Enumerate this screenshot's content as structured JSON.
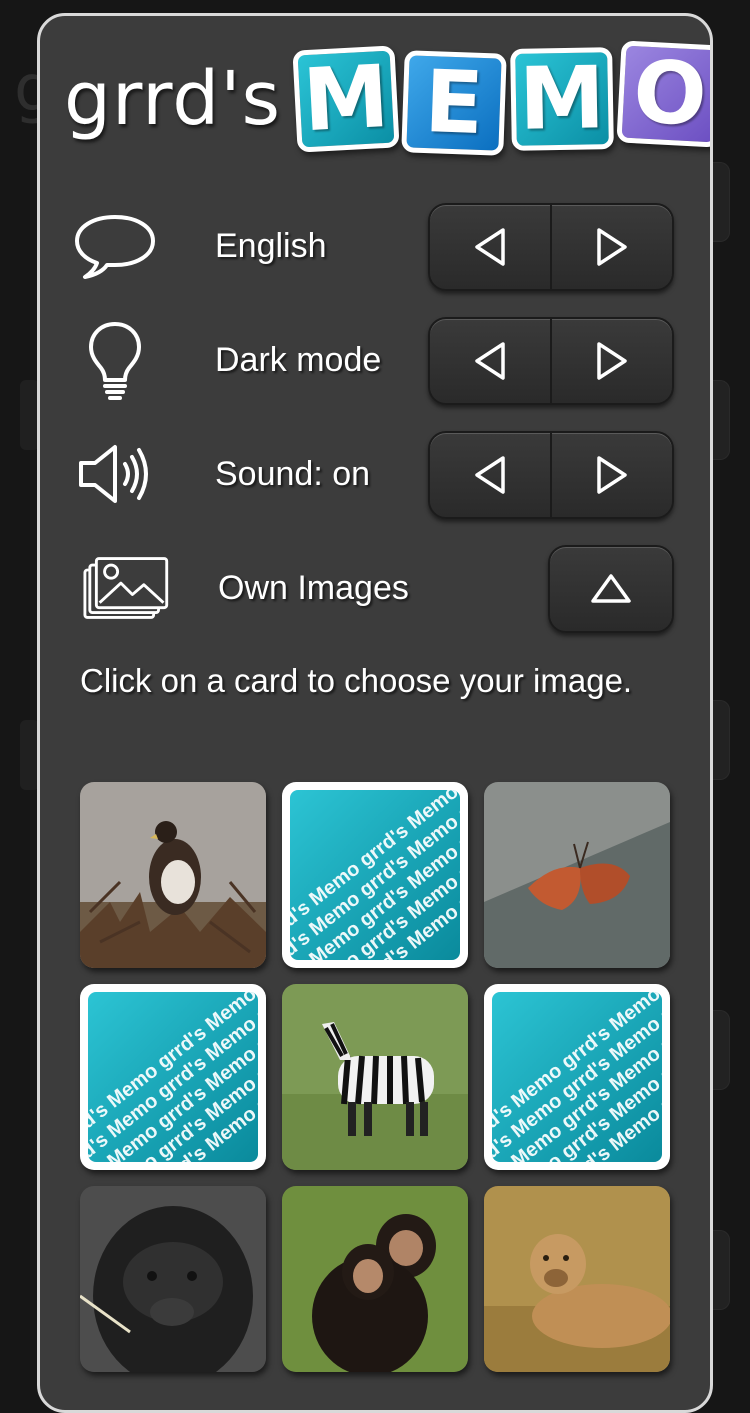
{
  "app": {
    "title_prefix": "grrd's",
    "title_letters": [
      "M",
      "E",
      "M",
      "O"
    ]
  },
  "settings": [
    {
      "label": "English",
      "icon": "speech-bubble-icon",
      "control": "arrows"
    },
    {
      "label": "Dark mode",
      "icon": "lightbulb-icon",
      "control": "arrows"
    },
    {
      "label": "Sound: on",
      "icon": "speaker-icon",
      "control": "arrows"
    },
    {
      "label": "Own Images",
      "icon": "images-icon",
      "control": "collapse"
    }
  ],
  "instruction": "Click on a card to choose your image.",
  "card_back_text": "grrd's Memo grrd's Memo grrd's",
  "cards": [
    {
      "type": "photo",
      "subject": "eagle"
    },
    {
      "type": "back"
    },
    {
      "type": "photo",
      "subject": "butterfly"
    },
    {
      "type": "back"
    },
    {
      "type": "photo",
      "subject": "zebra"
    },
    {
      "type": "back"
    },
    {
      "type": "photo",
      "subject": "gorilla"
    },
    {
      "type": "photo",
      "subject": "chimpanzees"
    },
    {
      "type": "photo",
      "subject": "lioness"
    }
  ],
  "colors": {
    "panel_bg": "#3c3c3c",
    "panel_border": "#d9d9d9",
    "card_teal": "#1aa9bb",
    "logo_purple": "#7f66d2",
    "logo_blue": "#1b86d6"
  }
}
